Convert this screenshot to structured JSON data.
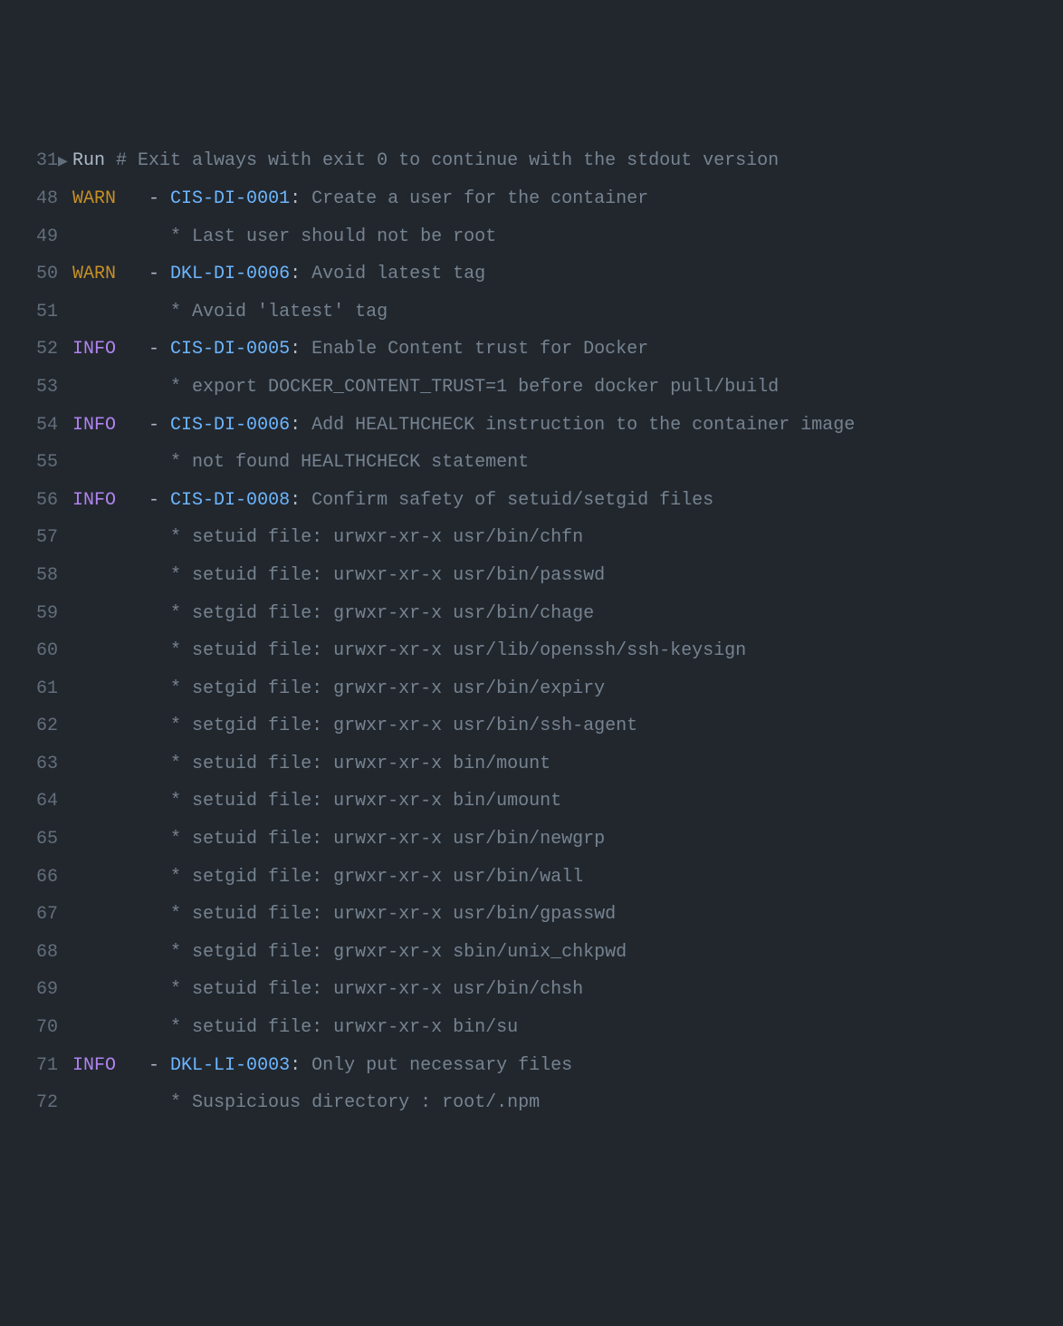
{
  "lines": [
    {
      "n": "31",
      "arrow": "▶",
      "kind": "run",
      "run": "Run",
      "comment": "# Exit always with exit 0 to continue with the stdout version"
    },
    {
      "n": "48",
      "kind": "finding",
      "level": "WARN",
      "rule": "CIS-DI-0001",
      "msg": "Create a user for the container"
    },
    {
      "n": "49",
      "kind": "detail",
      "text": "Last user should not be root"
    },
    {
      "n": "50",
      "kind": "finding",
      "level": "WARN",
      "rule": "DKL-DI-0006",
      "msg": "Avoid latest tag"
    },
    {
      "n": "51",
      "kind": "detail",
      "text": "Avoid 'latest' tag"
    },
    {
      "n": "52",
      "kind": "finding",
      "level": "INFO",
      "rule": "CIS-DI-0005",
      "msg": "Enable Content trust for Docker"
    },
    {
      "n": "53",
      "kind": "detail",
      "text": "export DOCKER_CONTENT_TRUST=1 before docker pull/build"
    },
    {
      "n": "54",
      "kind": "finding",
      "level": "INFO",
      "rule": "CIS-DI-0006",
      "msg": "Add HEALTHCHECK instruction to the container image"
    },
    {
      "n": "55",
      "kind": "detail",
      "text": "not found HEALTHCHECK statement"
    },
    {
      "n": "56",
      "kind": "finding",
      "level": "INFO",
      "rule": "CIS-DI-0008",
      "msg": "Confirm safety of setuid/setgid files"
    },
    {
      "n": "57",
      "kind": "detail",
      "text": "setuid file: urwxr-xr-x usr/bin/chfn"
    },
    {
      "n": "58",
      "kind": "detail",
      "text": "setuid file: urwxr-xr-x usr/bin/passwd"
    },
    {
      "n": "59",
      "kind": "detail",
      "text": "setgid file: grwxr-xr-x usr/bin/chage"
    },
    {
      "n": "60",
      "kind": "detail",
      "text": "setuid file: urwxr-xr-x usr/lib/openssh/ssh-keysign"
    },
    {
      "n": "61",
      "kind": "detail",
      "text": "setgid file: grwxr-xr-x usr/bin/expiry"
    },
    {
      "n": "62",
      "kind": "detail",
      "text": "setgid file: grwxr-xr-x usr/bin/ssh-agent"
    },
    {
      "n": "63",
      "kind": "detail",
      "text": "setuid file: urwxr-xr-x bin/mount"
    },
    {
      "n": "64",
      "kind": "detail",
      "text": "setuid file: urwxr-xr-x bin/umount"
    },
    {
      "n": "65",
      "kind": "detail",
      "text": "setuid file: urwxr-xr-x usr/bin/newgrp"
    },
    {
      "n": "66",
      "kind": "detail",
      "text": "setgid file: grwxr-xr-x usr/bin/wall"
    },
    {
      "n": "67",
      "kind": "detail",
      "text": "setuid file: urwxr-xr-x usr/bin/gpasswd"
    },
    {
      "n": "68",
      "kind": "detail",
      "text": "setgid file: grwxr-xr-x sbin/unix_chkpwd"
    },
    {
      "n": "69",
      "kind": "detail",
      "text": "setuid file: urwxr-xr-x usr/bin/chsh"
    },
    {
      "n": "70",
      "kind": "detail",
      "text": "setuid file: urwxr-xr-x bin/su"
    },
    {
      "n": "71",
      "kind": "finding",
      "level": "INFO",
      "rule": "DKL-LI-0003",
      "msg": "Only put necessary files"
    },
    {
      "n": "72",
      "kind": "detail",
      "text": "Suspicious directory : root/.npm"
    }
  ],
  "glyphs": {
    "dash": "-",
    "colon": ":",
    "star": "*"
  },
  "indent": {
    "levelPad": "  ",
    "detailPad": "         ",
    "findingGapWarn": "   ",
    "findingGapInfo": "   "
  }
}
